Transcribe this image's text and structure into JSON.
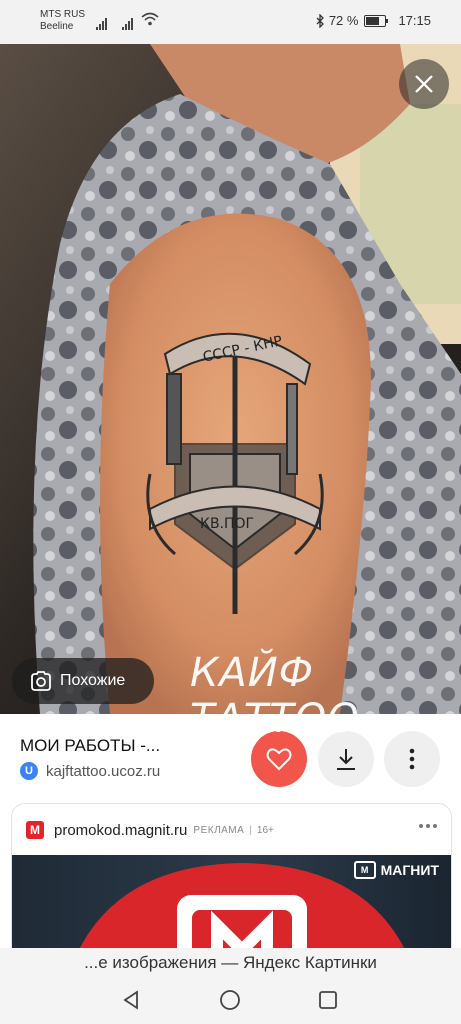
{
  "status_bar": {
    "carrier_1": "MTS RUS",
    "carrier_2": "Beeline",
    "battery": "72 %",
    "time": "17:15"
  },
  "viewer": {
    "close_icon": "close-icon",
    "watermark": "КАЙФ ТАТТОО",
    "tattoo_banner_top": "СССР - КНР",
    "tattoo_banner_bottom": "КВ.ПОГ",
    "similar_label": "Похожие",
    "similar_icon": "camera-lens-icon"
  },
  "info": {
    "title": "МОИ РАБОТЫ -...",
    "site_badge": "U",
    "site": "kajftattoo.ucoz.ru",
    "like_color": "#f2554a"
  },
  "ad": {
    "domain": "promokod.magnit.ru",
    "tag": "РЕКЛАМА",
    "separator": "|",
    "age": "16+",
    "brand": "МАГНИТ",
    "brand_color": "#e42328"
  },
  "caption": "...е изображения — Яндекс Картинки"
}
